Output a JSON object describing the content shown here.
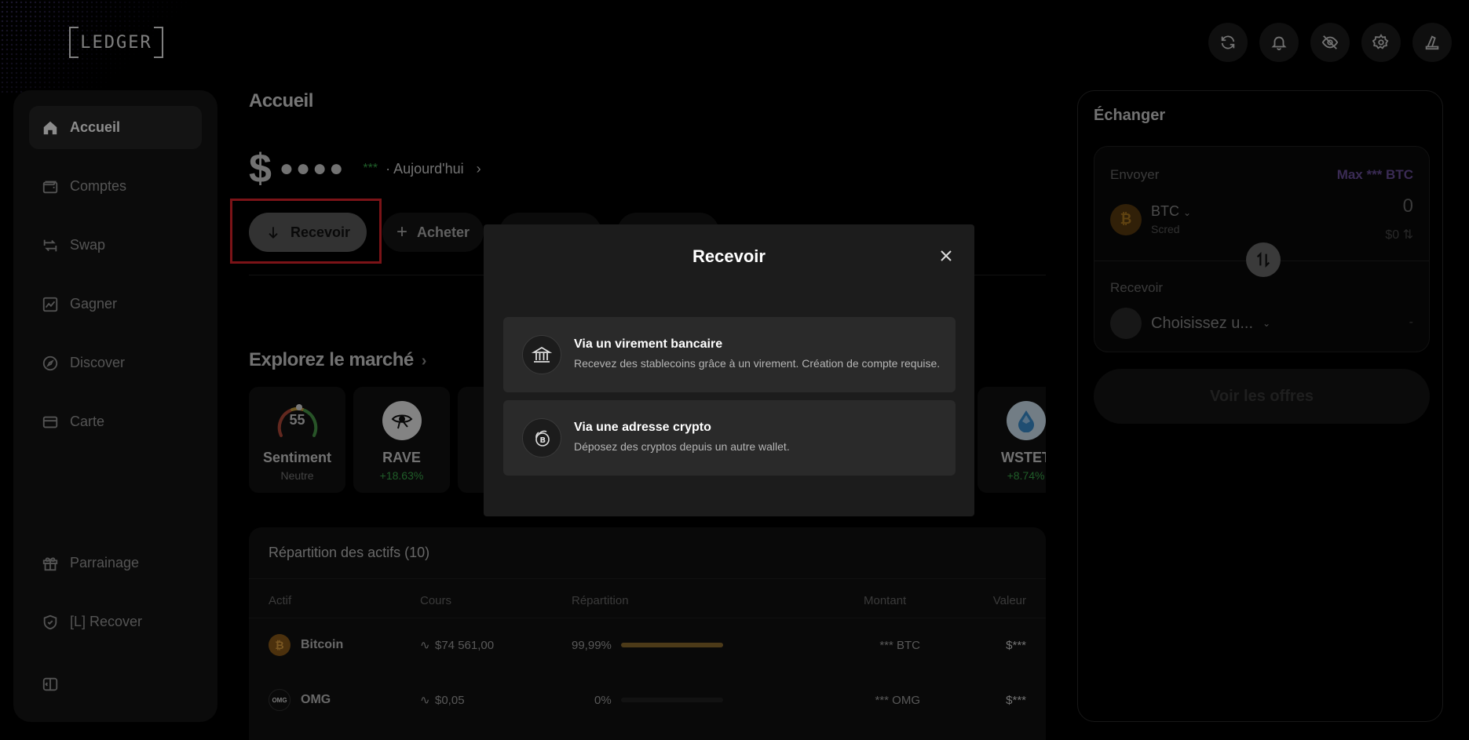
{
  "app": {
    "logo_text": "LEDGER"
  },
  "top_icons": [
    "sync-icon",
    "bell-icon",
    "eye-off-icon",
    "gear-icon",
    "device-icon"
  ],
  "sidebar": {
    "items": [
      {
        "label": "Accueil",
        "icon": "home-icon",
        "active": true
      },
      {
        "label": "Comptes",
        "icon": "wallet-icon"
      },
      {
        "label": "Swap",
        "icon": "swap-icon"
      },
      {
        "label": "Gagner",
        "icon": "chart-icon"
      },
      {
        "label": "Discover",
        "icon": "compass-icon"
      },
      {
        "label": "Carte",
        "icon": "card-icon"
      }
    ],
    "bottom_items": [
      {
        "label": "Parrainage",
        "icon": "gift-icon"
      },
      {
        "label": "[L] Recover",
        "icon": "shield-icon"
      }
    ]
  },
  "main": {
    "title": "Accueil",
    "balance": {
      "currency": "$",
      "masked": "●●●●",
      "change": "***",
      "period": "· Aujourd'hui"
    },
    "actions": {
      "receive": "Recevoir",
      "buy": "Acheter"
    },
    "explore_title": "Explorez le marché",
    "market": [
      {
        "name": "Sentiment",
        "sub": "Neutre",
        "gauge_value": "55"
      },
      {
        "name": "RAVE",
        "sub": "+18.63%"
      },
      {
        "name": "WSTET",
        "sub": "+8.74%"
      }
    ],
    "assets": {
      "title": "Répartition des actifs (10)",
      "columns": [
        "Actif",
        "Cours",
        "Répartition",
        "Montant",
        "Valeur"
      ],
      "rows": [
        {
          "name": "Bitcoin",
          "price": "$74 561,00",
          "share": "99,99%",
          "share_fraction": 0.9999,
          "amount": "*** BTC",
          "value": "$***"
        },
        {
          "name": "OMG",
          "price": "$0,05",
          "share": "0%",
          "share_fraction": 0,
          "amount": "*** OMG",
          "value": "$***"
        }
      ]
    }
  },
  "swap": {
    "title": "Échanger",
    "send_label": "Envoyer",
    "max": "Max *** BTC",
    "from_asset": "BTC",
    "from_account": "Scred",
    "amount": "0",
    "usd": "$0",
    "receive_label": "Recevoir",
    "choose": "Choisissez u...",
    "dash": "-",
    "offers_button": "Voir les offres"
  },
  "modal": {
    "title": "Recevoir",
    "options": [
      {
        "title": "Via un virement bancaire",
        "desc": "Recevez des stablecoins grâce à un virement. Création de compte requise.",
        "icon": "bank-icon"
      },
      {
        "title": "Via une adresse crypto",
        "desc": "Déposez des cryptos depuis un autre wallet.",
        "icon": "coins-icon"
      }
    ]
  },
  "colors": {
    "accent_purple": "#6a4f9a",
    "positive": "#3aa84a",
    "highlight_red": "#e0232b"
  }
}
